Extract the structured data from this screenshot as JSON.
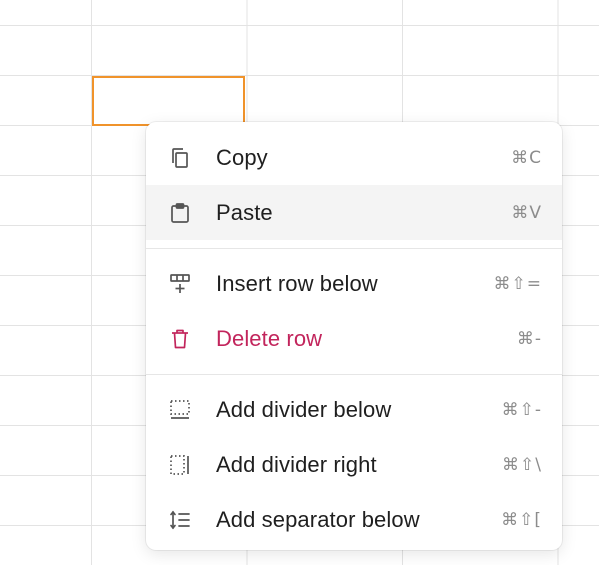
{
  "colors": {
    "selection": "#f0932b",
    "danger": "#c2255c",
    "icon": "#555555",
    "shortcut": "#8c8c8c"
  },
  "context_menu": {
    "groups": [
      [
        {
          "label": "Copy",
          "shortcut": "⌘C",
          "icon": "copy-icon",
          "hovered": false
        },
        {
          "label": "Paste",
          "shortcut": "⌘V",
          "icon": "clipboard-icon",
          "hovered": true
        }
      ],
      [
        {
          "label": "Insert row below",
          "shortcut": "⌘⇧=",
          "icon": "insert-row-icon"
        },
        {
          "label": "Delete row",
          "shortcut": "⌘-",
          "icon": "trash-icon",
          "danger": true
        }
      ],
      [
        {
          "label": "Add divider below",
          "shortcut": "⌘⇧-",
          "icon": "divider-below-icon"
        },
        {
          "label": "Add divider right",
          "shortcut": "⌘⇧\\",
          "icon": "divider-right-icon"
        },
        {
          "label": "Add separator below",
          "shortcut": "⌘⇧[",
          "icon": "separator-icon"
        }
      ]
    ]
  }
}
